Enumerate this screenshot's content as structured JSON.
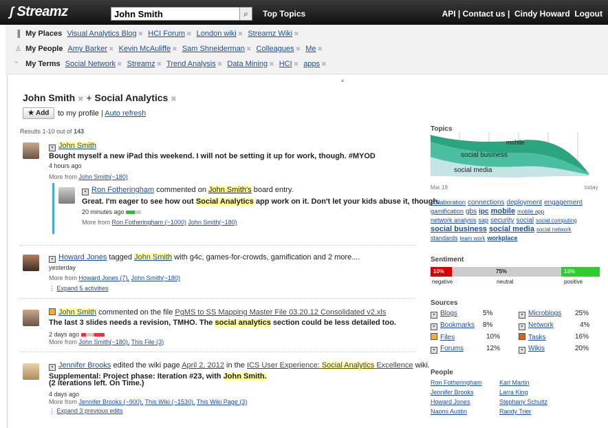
{
  "app": {
    "logo": "Streamz",
    "search_value": "John Smith",
    "top_topics": "Top Topics",
    "links": "API | Contact us |",
    "user": "Cindy Howard",
    "logout": "Logout"
  },
  "filters": {
    "places": {
      "label": "My Places",
      "items": [
        "Visual Analytics Blog",
        "HCI Forum",
        "London wiki",
        "Streamz Wiki"
      ]
    },
    "people": {
      "label": "My People",
      "items": [
        "Amy Barker",
        "Kevin McAuliffe",
        "Sam Shneiderman",
        "Colleagues",
        "Me"
      ]
    },
    "terms": {
      "label": "My Terms",
      "items": [
        "Social Network",
        "Streamz",
        "Trend Analysis",
        "Data Mining",
        "HCI",
        "apps"
      ]
    }
  },
  "header": {
    "term1": "John Smith",
    "plus": "+",
    "term2": "Social Analytics",
    "add": "★ Add",
    "add_text": "to my profile |",
    "auto_refresh": "Auto refresh"
  },
  "results": {
    "prefix": "Results 1-10 out of",
    "count": "143"
  },
  "feed": {
    "i1": {
      "name": "John Smith",
      "text": "Bought myself a new iPad this weekend. I will not be setting it up for work, though. #MYOD",
      "time": "4 hours ago",
      "more": "More from",
      "more_link": "John Smith(~180)",
      "sub_name": "Ron Fotheringham",
      "sub_action": "commented on",
      "sub_target": "John Smith's",
      "sub_tail": "board entry.",
      "sub_text_a": "Great. I'm eager to see how out",
      "sub_hl": "Social Analytics",
      "sub_text_b": "app work on it. Don't let your kids abuse it, though.",
      "sub_time": "20 minutes ago",
      "sub_more": "More from",
      "sub_more_a": "Ron Fotheringham (~1000)",
      "sub_more_b": "John Smith(~180)"
    },
    "i2": {
      "name": "Howard Jones",
      "action": "tagged",
      "target": "John Smith",
      "tail": "with g4c, games-for-crowds, gamification and 2 more....",
      "time": "yesterday",
      "more": "More from",
      "more_a": "Howard Jones (7),",
      "more_b": "John Smith(~180)",
      "expand": "Expand 5 activities"
    },
    "i3": {
      "name": "John Smith",
      "action": "commented on the file",
      "file": "PgMS to SS Mapping Master File 03.20.12 Consolidated v2.xls",
      "text_a": "The last 3 slides needs a revision, TMHO. The",
      "hl": "social analytics",
      "text_b": "section could be less detailed too.",
      "time": "2 days ago",
      "more": "More from",
      "more_a": "John Smith(~180),",
      "more_b": "This File (3)"
    },
    "i4": {
      "name": "Jennifer Brooks",
      "action": "edited the wiki page",
      "page": "April 2, 2012",
      "in": "in the",
      "wiki_a": "ICS User Experience:",
      "wiki_hl": "Social Analytics",
      "wiki_b": "Excellence",
      "wiki_tail": "wiki.",
      "text_a": "Supplemental: Project phase: Iteration #23, with",
      "hl": "John Smith.",
      "text_b": "(2 iterations left. On Time.)",
      "time": "4 days ago",
      "more": "More from",
      "more_a": "Jennifer Brooks (~900),",
      "more_b": "This Wiki (~1530),",
      "more_c": "This Wiki Page (3)",
      "expand": "Expand 3 previous edits"
    }
  },
  "topics": {
    "title": "Topics",
    "stream_labels": [
      "mobile",
      "social business",
      "social media"
    ],
    "axis_start": "Mar 19",
    "axis_end": "today",
    "cloud": [
      "collaboration",
      "connections",
      "deployment",
      "engagement",
      "gamification",
      "gbs",
      "ipc",
      "mobile",
      "mobile app",
      "network analysis",
      "sap",
      "security",
      "social",
      "social computing",
      "social business",
      "social media",
      "social network",
      "standards",
      "team work",
      "workplace"
    ]
  },
  "sentiment": {
    "title": "Sentiment",
    "negative": {
      "pct": "10%",
      "label": "negative",
      "value": 10,
      "color": "#d40000"
    },
    "neutral": {
      "pct": "75%",
      "label": "neutral",
      "value": 75,
      "color": "#cccccc"
    },
    "positive": {
      "pct": "15%",
      "label": "positive",
      "value": 15,
      "color": "#2ecc2e"
    }
  },
  "sources": {
    "title": "Sources",
    "items": [
      [
        "Blogs",
        "5%"
      ],
      [
        "Bookmarks",
        "8%"
      ],
      [
        "Files",
        "10%"
      ],
      [
        "Forums",
        "12%"
      ],
      [
        "Microblogs",
        "25%"
      ],
      [
        "Network",
        "4%"
      ],
      [
        "Tasks",
        "16%"
      ],
      [
        "Wikis",
        "20%"
      ]
    ]
  },
  "people": {
    "title": "People",
    "items": [
      "Ron Fotheringham",
      "Jennifer Brooks",
      "Howard Jones",
      "Naomi Austin",
      "Karl Martin",
      "Larra King",
      "Stephany Schultz",
      "Randy Trier"
    ]
  }
}
